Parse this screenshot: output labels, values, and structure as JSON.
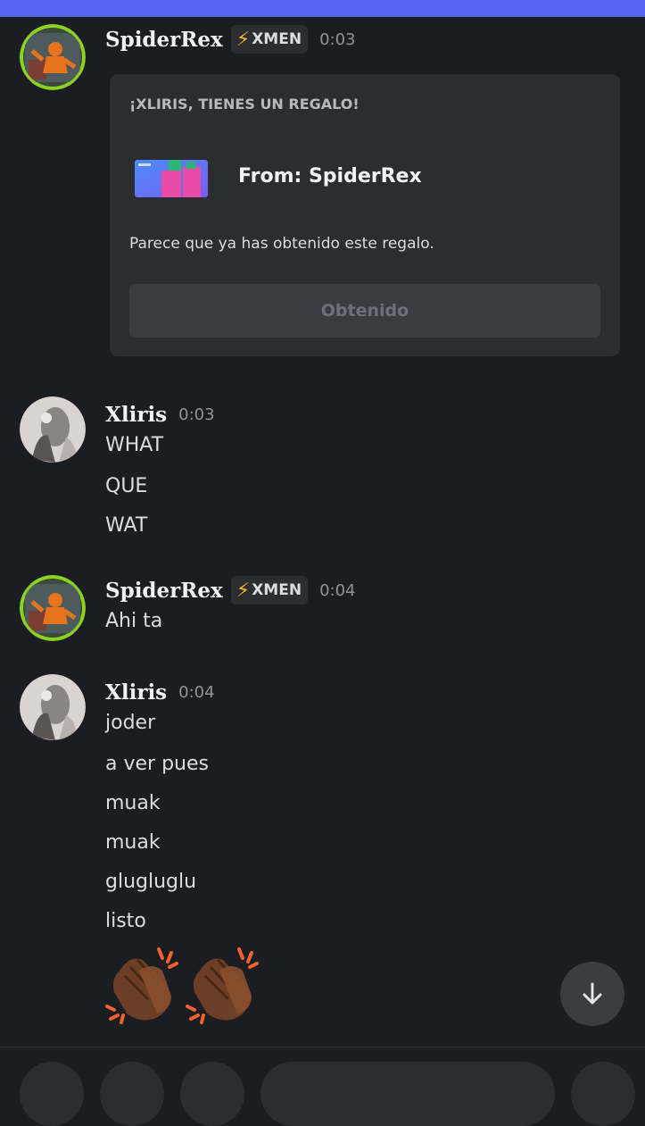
{
  "colors": {
    "background": "#1c1d22",
    "top_accent": "#5865f2",
    "card": "#2b2d31",
    "username": "#f2f3f5",
    "timestamp": "#8f939b"
  },
  "messages": [
    {
      "author": "SpiderRex",
      "tag": {
        "icon": "lightning-bolt-icon",
        "label": "XMEN"
      },
      "time": "0:03",
      "gift": {
        "title": "¡XLIRIS, TIENES UN REGALO!",
        "from": "From: SpiderRex",
        "description": "Parece que ya has obtenido este regalo.",
        "button": "Obtenido"
      }
    },
    {
      "author": "Xliris",
      "time": "0:03",
      "lines": [
        "WHAT",
        "QUE",
        "WAT"
      ]
    },
    {
      "author": "SpiderRex",
      "tag": {
        "icon": "lightning-bolt-icon",
        "label": "XMEN"
      },
      "time": "0:04",
      "lines": [
        "Ahi ta"
      ]
    },
    {
      "author": "Xliris",
      "time": "0:04",
      "lines": [
        "joder",
        "a ver pues",
        "muak",
        "muak",
        "glugluglu",
        "listo"
      ],
      "emoji": [
        "clapping-hands-dark-skin-emoji",
        "clapping-hands-dark-skin-emoji"
      ]
    }
  ],
  "icons": {
    "scroll_down": "arrow-down-icon"
  }
}
